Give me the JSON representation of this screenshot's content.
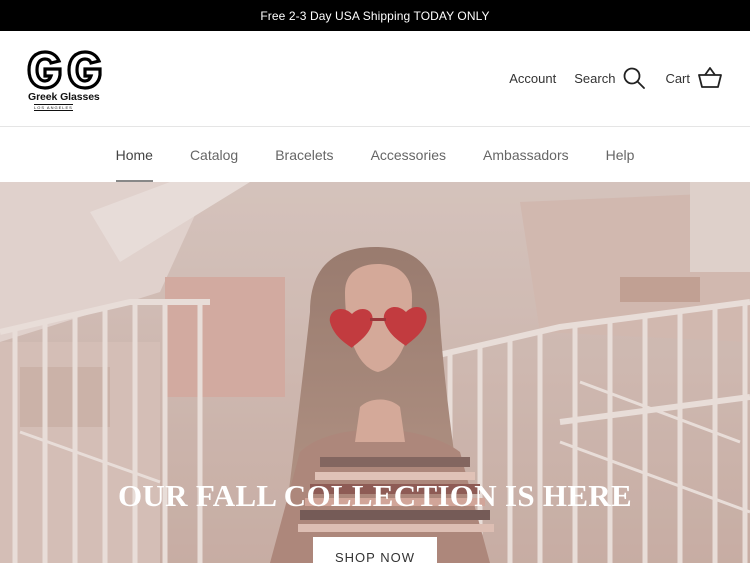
{
  "announcement": {
    "text": "Free 2-3 Day USA Shipping TODAY ONLY"
  },
  "logo": {
    "mark": "GG",
    "brand": "Greek Glasses",
    "tagline": "LOS ANGELES"
  },
  "utility": {
    "account_label": "Account",
    "search_label": "Search",
    "cart_label": "Cart"
  },
  "nav": {
    "items": [
      {
        "label": "Home",
        "active": true
      },
      {
        "label": "Catalog"
      },
      {
        "label": "Bracelets"
      },
      {
        "label": "Accessories"
      },
      {
        "label": "Ambassadors"
      },
      {
        "label": "Help"
      }
    ]
  },
  "hero": {
    "title": "OUR FALL COLLECTION IS HERE",
    "button_label": "SHOP NOW"
  },
  "colors": {
    "announcement_bg": "#000000",
    "hero_overlay": "#c9b0a6",
    "sunglasses": "#c0141d"
  }
}
